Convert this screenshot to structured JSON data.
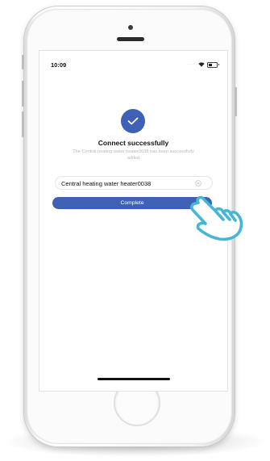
{
  "status_bar": {
    "time": "10:09"
  },
  "connect_screen": {
    "title": "Connect successfully",
    "subtitle": "The Central heating water heater0038 has been successfully added",
    "device_name_value": "Central heating water heater0038",
    "complete_label": "Complete"
  },
  "icons": {
    "success": "checkmark-icon",
    "clear": "clear-icon",
    "cursor": "tap-hand-icon"
  },
  "colors": {
    "accent": "#3e61b5",
    "hand_outline": "#47b6d4"
  }
}
